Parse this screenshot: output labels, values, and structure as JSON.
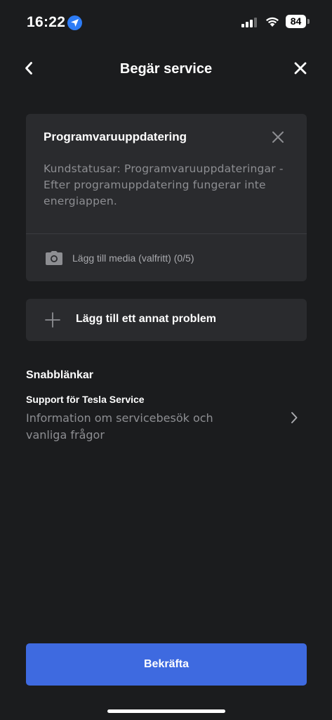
{
  "status_bar": {
    "time": "16:22",
    "battery": "84"
  },
  "header": {
    "title": "Begär service"
  },
  "issue_card": {
    "title": "Programvaruuppdatering",
    "description": "Kundstatusar: Programvaruuppdateringar - Efter programuppdatering fungerar inte energiappen.",
    "add_media_label": "Lägg till media (valfritt) (0/5)"
  },
  "add_problem": {
    "label": "Lägg till ett annat problem"
  },
  "quick_links": {
    "heading": "Snabblänkar",
    "items": [
      {
        "title": "Support för Tesla Service",
        "description": "Information om servicebesök och vanliga frågor"
      }
    ]
  },
  "confirm": {
    "label": "Bekräfta"
  },
  "colors": {
    "background": "#1b1c1e",
    "card": "#2a2b2e",
    "primary_button": "#3e6ae0",
    "location_badge": "#2d7cf6"
  },
  "icons": [
    "location-arrow-icon",
    "signal-icon",
    "wifi-icon",
    "battery-icon",
    "back-chevron-icon",
    "close-icon",
    "camera-icon",
    "plus-icon",
    "chevron-right-icon"
  ]
}
